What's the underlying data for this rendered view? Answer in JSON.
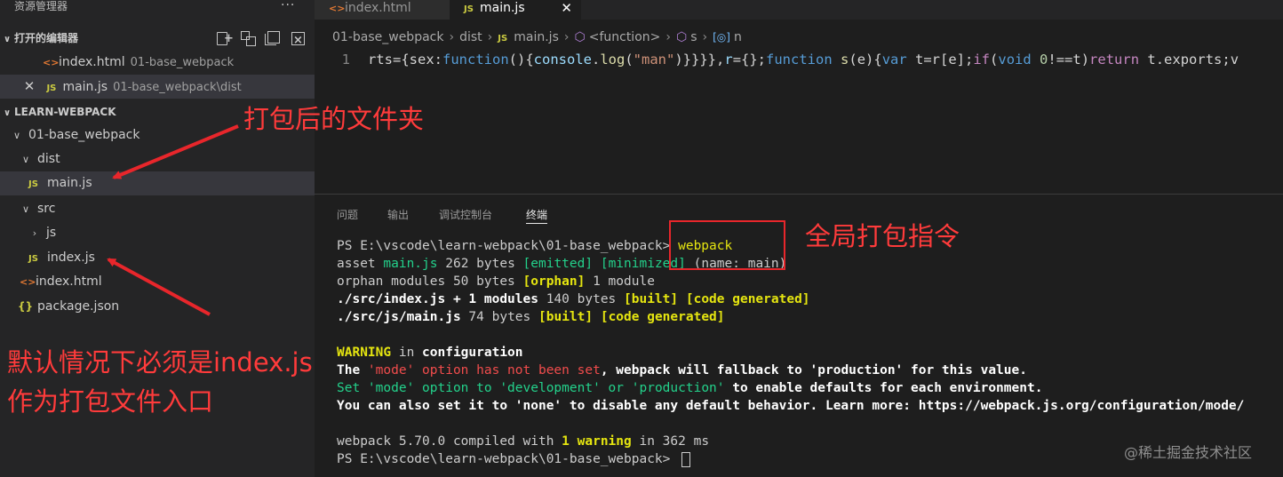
{
  "sidebar": {
    "title": "资源管理器",
    "more": "···",
    "open_editors": {
      "label": "打开的编辑器",
      "items": [
        {
          "name": "index.html",
          "desc": "01-base_webpack",
          "icon": "html-file-icon"
        },
        {
          "name": "main.js",
          "desc": "01-base_webpack\\dist",
          "icon": "js-file-icon"
        }
      ]
    },
    "project": {
      "label": "LEARN-WEBPACK",
      "tree": [
        {
          "label": "01-base_webpack",
          "twisty": "∨"
        },
        {
          "label": "dist",
          "twisty": "∨"
        },
        {
          "label": "main.js",
          "icon_text": "JS"
        },
        {
          "label": "src",
          "twisty": "∨"
        },
        {
          "label": "js",
          "twisty": "›"
        },
        {
          "label": "index.js",
          "icon_text": "JS"
        },
        {
          "label": "index.html",
          "icon_text": "<>"
        },
        {
          "label": "package.json",
          "icon_text": "{}"
        }
      ]
    }
  },
  "tabs": [
    {
      "label": "index.html",
      "icon_text": "<>"
    },
    {
      "label": "main.js",
      "icon_text": "JS",
      "close": "✕"
    }
  ],
  "breadcrumb": {
    "folder": "01-base_webpack",
    "sub": "dist",
    "file": "main.js",
    "file_icon": "JS",
    "sym1": "<function>",
    "sym2": "s",
    "sym3": "n",
    "sep": "›"
  },
  "code": {
    "line_number": "1",
    "segments": [
      {
        "t": "rts={sex:",
        "c": ""
      },
      {
        "t": "function",
        "c": "kw"
      },
      {
        "t": "(){",
        "c": ""
      },
      {
        "t": "console",
        "c": "var"
      },
      {
        "t": ".",
        "c": ""
      },
      {
        "t": "log",
        "c": "fn"
      },
      {
        "t": "(",
        "c": ""
      },
      {
        "t": "\"man\"",
        "c": "str"
      },
      {
        "t": ")}}}},",
        "c": ""
      },
      {
        "t": "r",
        "c": "var"
      },
      {
        "t": "={};",
        "c": ""
      },
      {
        "t": "function",
        "c": "kw"
      },
      {
        "t": " ",
        "c": ""
      },
      {
        "t": "s",
        "c": "fn"
      },
      {
        "t": "(e){",
        "c": ""
      },
      {
        "t": "var",
        "c": "kw"
      },
      {
        "t": " t=r[e];",
        "c": ""
      },
      {
        "t": "if",
        "c": "ctl"
      },
      {
        "t": "(",
        "c": ""
      },
      {
        "t": "void",
        "c": "kw"
      },
      {
        "t": " ",
        "c": ""
      },
      {
        "t": "0",
        "c": "num"
      },
      {
        "t": "!==t)",
        "c": ""
      },
      {
        "t": "return",
        "c": "ctl"
      },
      {
        "t": " t.exports;v",
        "c": ""
      }
    ]
  },
  "panel": {
    "tabs": [
      "问题",
      "输出",
      "调试控制台",
      "终端"
    ],
    "active_tab": "终端"
  },
  "terminal": {
    "lines": [
      [
        {
          "t": "PS E:\\vscode\\learn-webpack\\01-base_webpack> ",
          "c": ""
        },
        {
          "t": "webpack",
          "c": "y"
        }
      ],
      [
        {
          "t": "asset ",
          "c": ""
        },
        {
          "t": "main.js",
          "c": "g"
        },
        {
          "t": " 262 bytes ",
          "c": ""
        },
        {
          "t": "[emitted]",
          "c": "g"
        },
        {
          "t": " ",
          "c": ""
        },
        {
          "t": "[minimized]",
          "c": "g"
        },
        {
          "t": " (name: main)",
          "c": ""
        }
      ],
      [
        {
          "t": "orphan modules 50 bytes ",
          "c": ""
        },
        {
          "t": "[orphan]",
          "c": "y b"
        },
        {
          "t": " 1 module",
          "c": ""
        }
      ],
      [
        {
          "t": "./src/index.js + 1 modules",
          "c": "w b"
        },
        {
          "t": " 140 bytes ",
          "c": ""
        },
        {
          "t": "[built]",
          "c": "y b"
        },
        {
          "t": " ",
          "c": ""
        },
        {
          "t": "[code generated]",
          "c": "y b"
        }
      ],
      [
        {
          "t": "./src/js/main.js",
          "c": "w b"
        },
        {
          "t": " 74 bytes ",
          "c": ""
        },
        {
          "t": "[built]",
          "c": "y b"
        },
        {
          "t": " ",
          "c": ""
        },
        {
          "t": "[code generated]",
          "c": "y b"
        }
      ],
      [],
      [
        {
          "t": "WARNING",
          "c": "y b"
        },
        {
          "t": " in ",
          "c": ""
        },
        {
          "t": "configuration",
          "c": "w b"
        }
      ],
      [
        {
          "t": "The ",
          "c": "w b"
        },
        {
          "t": "'mode' option has not been set",
          "c": "r"
        },
        {
          "t": ", webpack will fallback to 'production' for this value.",
          "c": "w b"
        }
      ],
      [
        {
          "t": "Set ",
          "c": "g"
        },
        {
          "t": "'mode' option to ",
          "c": "g"
        },
        {
          "t": "'development'",
          "c": "g"
        },
        {
          "t": " or ",
          "c": "g"
        },
        {
          "t": "'production'",
          "c": "g"
        },
        {
          "t": " to enable defaults for each environment.",
          "c": "w b"
        }
      ],
      [
        {
          "t": "You can also set it to 'none' to disable any default behavior. Learn more: https://webpack.js.org/configuration/mode/",
          "c": "w b"
        }
      ],
      [],
      [
        {
          "t": "webpack 5.70.0 compiled with ",
          "c": ""
        },
        {
          "t": "1 warning",
          "c": "y b"
        },
        {
          "t": " in 362 ms",
          "c": ""
        }
      ],
      [
        {
          "t": "PS E:\\vscode\\learn-webpack\\01-base_webpack> ",
          "c": ""
        }
      ]
    ]
  },
  "annotations": {
    "folder_note": "打包后的文件夹",
    "command_note": "全局打包指令",
    "entry_note_1": "默认情况下必须是index.js",
    "entry_note_2": "作为打包文件入口",
    "color": "#ff3b3b"
  },
  "watermark": "@稀土掘金技术社区"
}
